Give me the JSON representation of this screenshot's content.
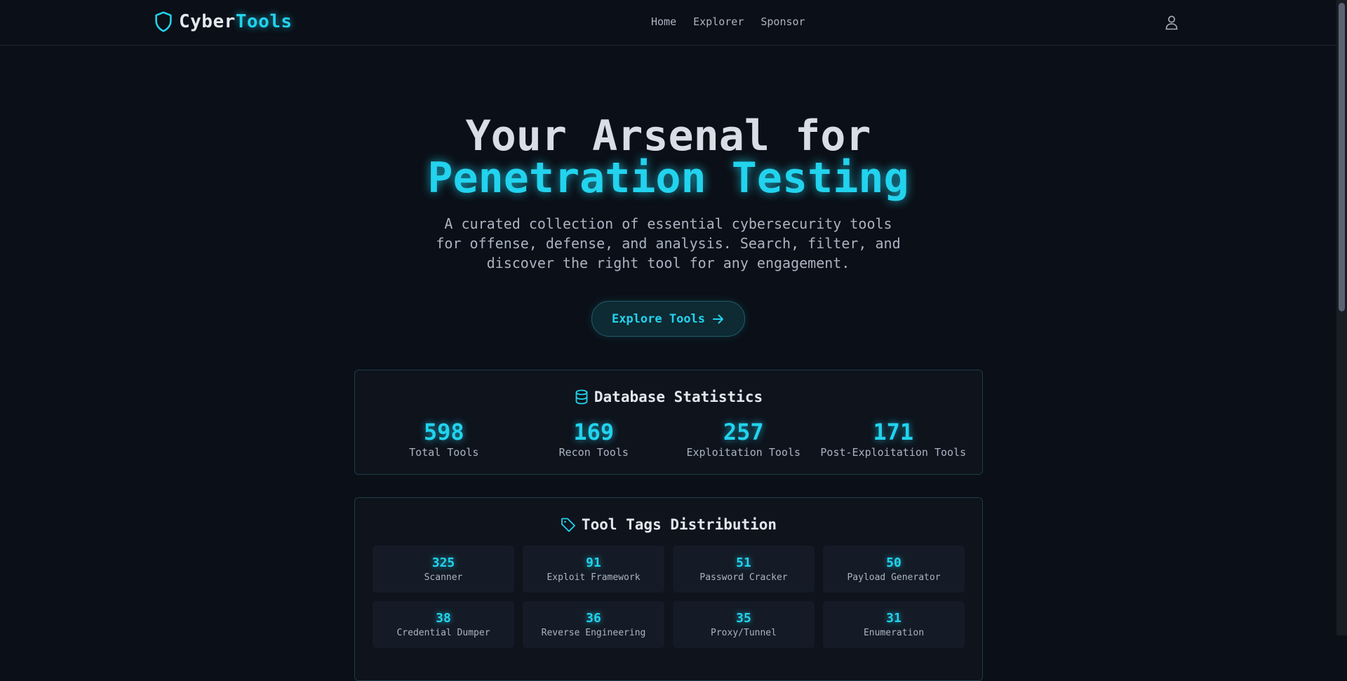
{
  "brand": {
    "prefix": "Cyber",
    "accent": "Tools"
  },
  "nav": [
    "Home",
    "Explorer",
    "Sponsor"
  ],
  "hero": {
    "title_line1": "Your Arsenal for",
    "title_line2": "Penetration Testing",
    "subtitle": "A curated collection of essential cybersecurity tools for offense, defense, and analysis. Search, filter, and discover the right tool for any engagement.",
    "cta_label": "Explore Tools"
  },
  "stats": {
    "title": "Database Statistics",
    "items": [
      {
        "value": "598",
        "label": "Total Tools"
      },
      {
        "value": "169",
        "label": "Recon Tools"
      },
      {
        "value": "257",
        "label": "Exploitation Tools"
      },
      {
        "value": "171",
        "label": "Post-Exploitation Tools"
      }
    ]
  },
  "tags": {
    "title": "Tool Tags Distribution",
    "items": [
      {
        "count": "325",
        "name": "Scanner"
      },
      {
        "count": "91",
        "name": "Exploit Framework"
      },
      {
        "count": "51",
        "name": "Password Cracker"
      },
      {
        "count": "50",
        "name": "Payload Generator"
      },
      {
        "count": "38",
        "name": "Credential Dumper"
      },
      {
        "count": "36",
        "name": "Reverse Engineering"
      },
      {
        "count": "35",
        "name": "Proxy/Tunnel"
      },
      {
        "count": "31",
        "name": "Enumeration"
      }
    ]
  },
  "colors": {
    "accent": "#22d3ee",
    "background": "#0b0f17"
  },
  "icons": {
    "logo": "shield-icon",
    "user": "user-icon",
    "cta": "arrow-right-icon",
    "stats": "database-icon",
    "tags": "tag-icon"
  }
}
